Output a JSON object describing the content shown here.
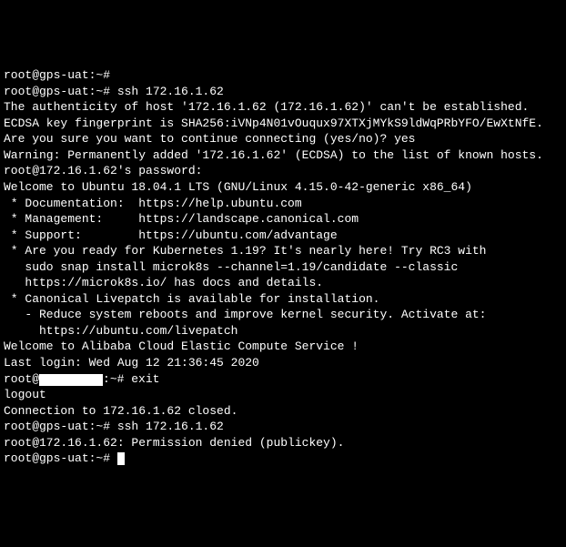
{
  "lines": {
    "l01": "root@gps-uat:~#",
    "l02": "root@gps-uat:~# ssh 172.16.1.62",
    "l03": "The authenticity of host '172.16.1.62 (172.16.1.62)' can't be established.",
    "l04": "ECDSA key fingerprint is SHA256:iVNp4N01vOuqux97XTXjMYkS9ldWqPRbYFO/EwXtNfE.",
    "l05": "Are you sure you want to continue connecting (yes/no)? yes",
    "l06": "Warning: Permanently added '172.16.1.62' (ECDSA) to the list of known hosts.",
    "l07": "root@172.16.1.62's password:",
    "l08": "Welcome to Ubuntu 18.04.1 LTS (GNU/Linux 4.15.0-42-generic x86_64)",
    "l09": "",
    "l10": " * Documentation:  https://help.ubuntu.com",
    "l11": " * Management:     https://landscape.canonical.com",
    "l12": " * Support:        https://ubuntu.com/advantage",
    "l13": "",
    "l14": " * Are you ready for Kubernetes 1.19? It's nearly here! Try RC3 with",
    "l15": "   sudo snap install microk8s --channel=1.19/candidate --classic",
    "l16": "",
    "l17": "   https://microk8s.io/ has docs and details.",
    "l18": "",
    "l19": " * Canonical Livepatch is available for installation.",
    "l20": "   - Reduce system reboots and improve kernel security. Activate at:",
    "l21": "     https://ubuntu.com/livepatch",
    "l22": "",
    "l23": "Welcome to Alibaba Cloud Elastic Compute Service !",
    "l24": "",
    "l25": "Last login: Wed Aug 12 21:36:45 2020",
    "l26a": "root@",
    "l26b": ":~# exit",
    "l27": "logout",
    "l28": "Connection to 172.16.1.62 closed.",
    "l29": "root@gps-uat:~# ssh 172.16.1.62",
    "l30": "root@172.16.1.62: Permission denied (publickey).",
    "l31": "root@gps-uat:~#"
  }
}
